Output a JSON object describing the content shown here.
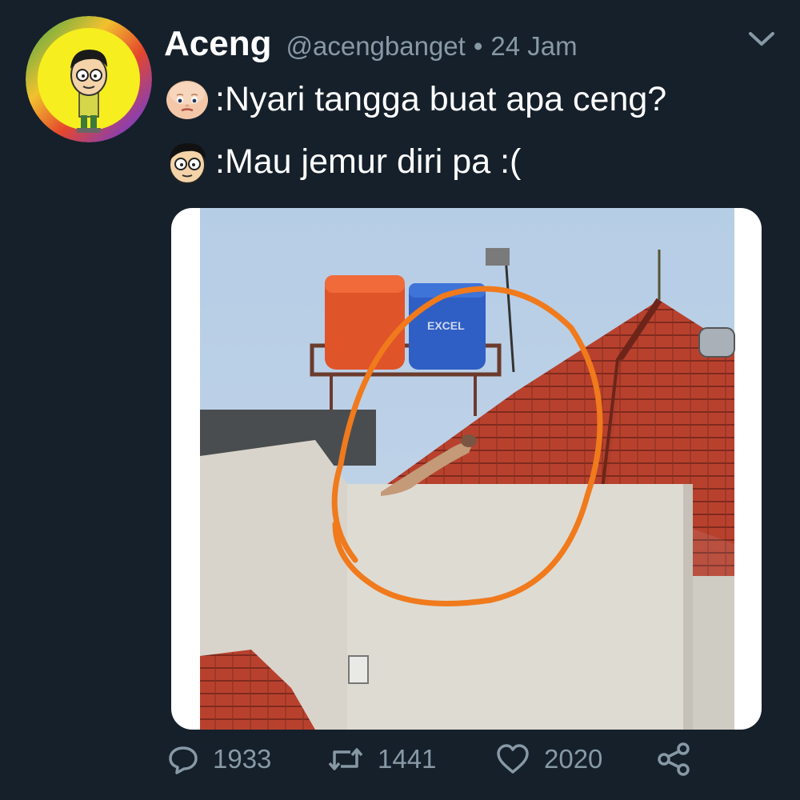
{
  "tweet": {
    "display_name": "Aceng",
    "handle": "@acengbanget",
    "separator": "•",
    "time": "24 Jam",
    "lines": [
      {
        "speaker_icon": "baby-face-icon",
        "text": ":Nyari tangga buat apa ceng?"
      },
      {
        "speaker_icon": "cartoon-boy-face-icon",
        "text": ":Mau jemur diri pa :("
      }
    ],
    "media": {
      "tank_label": "EXCEL"
    },
    "actions": {
      "replies": "1933",
      "retweets": "1441",
      "likes": "2020"
    }
  },
  "icons": {
    "avatar": "cartoon-boy-avatar-icon",
    "menu": "chevron-down-icon",
    "reply": "reply-icon",
    "retweet": "retweet-icon",
    "like": "heart-icon",
    "share": "share-icon"
  },
  "colors": {
    "background": "#15202b",
    "secondary_text": "#8899a6",
    "primary_text": "#ffffff",
    "highlight_circle": "#f07a1c"
  }
}
